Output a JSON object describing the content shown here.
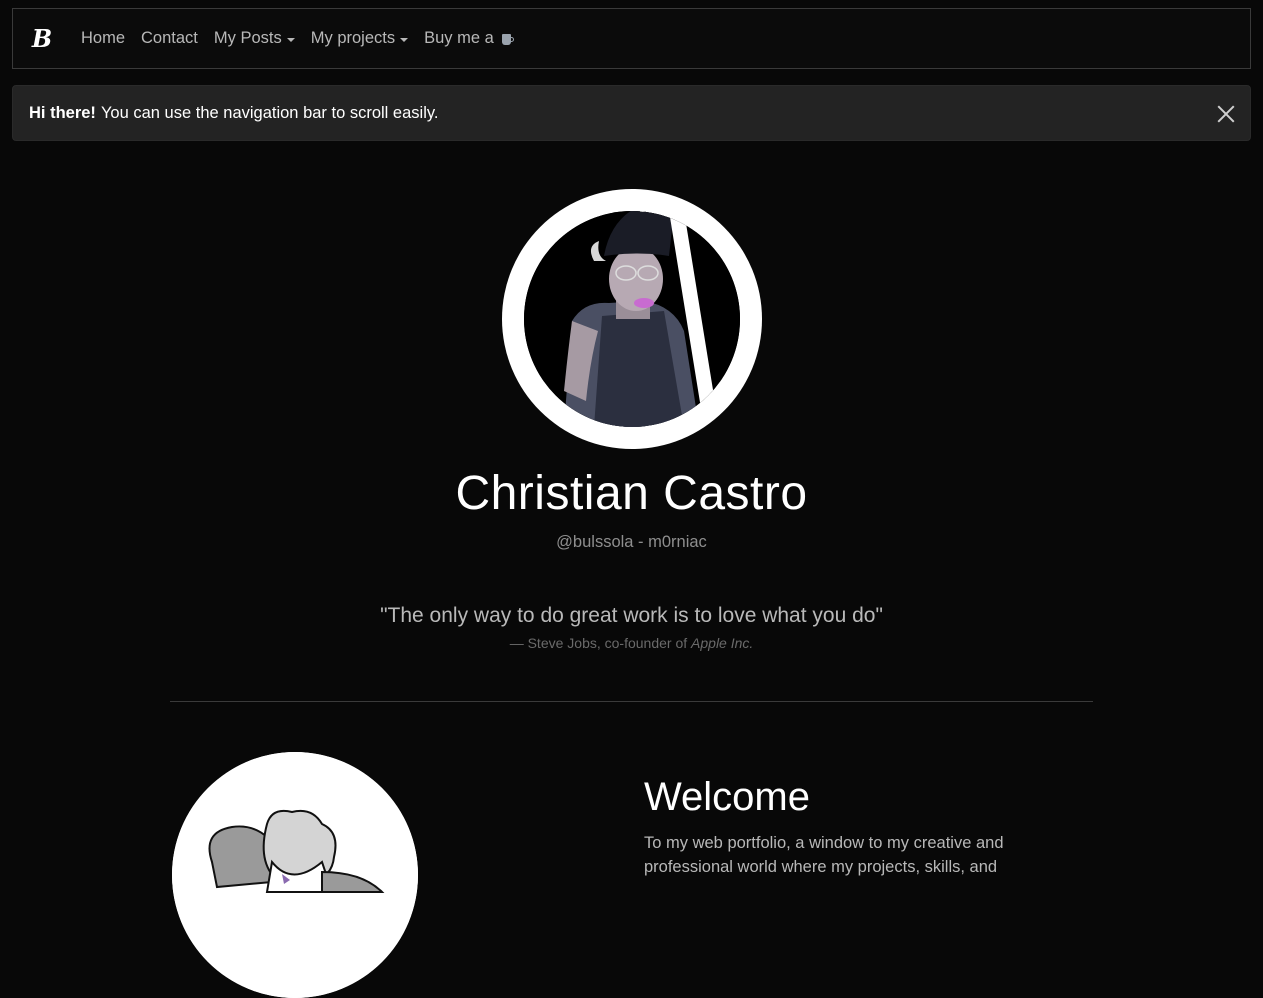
{
  "navbar": {
    "brand": "B",
    "links": [
      {
        "label": "Home"
      },
      {
        "label": "Contact"
      },
      {
        "label": "My Posts"
      },
      {
        "label": "My projects"
      },
      {
        "label": "Buy me a"
      }
    ]
  },
  "alert": {
    "strong": "Hi there!",
    "text": "You can use the navigation bar to scroll easily."
  },
  "profile": {
    "name": "Christian Castro",
    "handle": "@bulssola - m0rniac"
  },
  "quote": {
    "text": "\"The only way to do great work is to love what you do\"",
    "attribution": "— Steve Jobs, co-founder of",
    "company": "Apple Inc."
  },
  "welcome": {
    "title": "Welcome",
    "text": "To my web portfolio, a window to my creative and professional world where my projects, skills, and"
  },
  "icons": {
    "close": "close-icon",
    "coffee": "coffee-icon",
    "caret": "chevron-down-icon"
  }
}
